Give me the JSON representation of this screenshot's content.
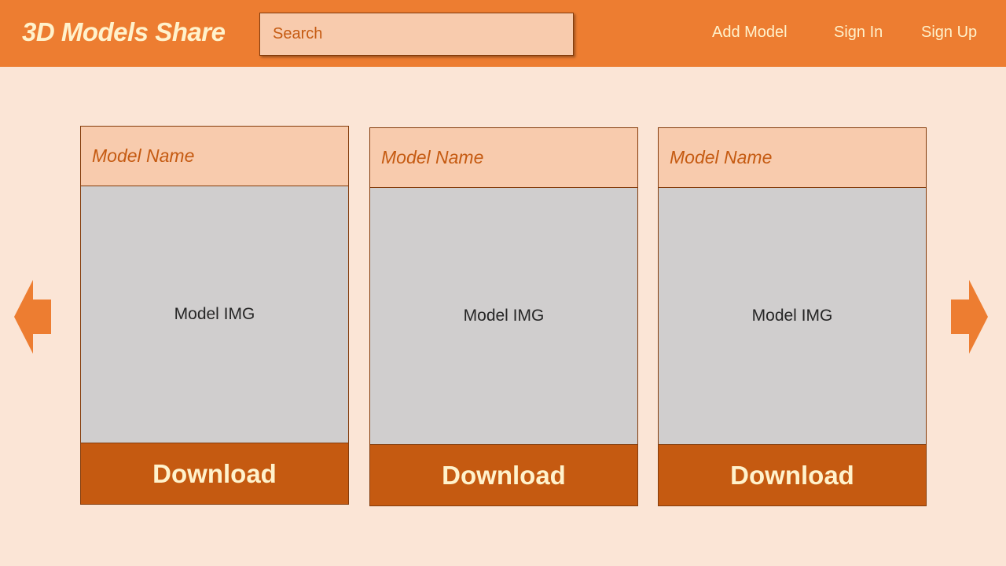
{
  "header": {
    "brand": "3D Models Share",
    "search_placeholder": "Search",
    "nav": {
      "add_model": "Add Model",
      "sign_in": "Sign In",
      "sign_up": "Sign Up"
    }
  },
  "cards": [
    {
      "name": "Model Name",
      "image_label": "Model IMG",
      "download_label": "Download"
    },
    {
      "name": "Model Name",
      "image_label": "Model IMG",
      "download_label": "Download"
    },
    {
      "name": "Model Name",
      "image_label": "Model IMG",
      "download_label": "Download"
    }
  ],
  "carousel": {
    "prev_icon": "arrow-left-icon",
    "next_icon": "arrow-right-icon"
  },
  "colors": {
    "header_bg": "#ED7D31",
    "page_bg": "#FBE5D6",
    "card_header_bg": "#F8CBAD",
    "image_placeholder_bg": "#D0CECE",
    "download_bg": "#C55A11",
    "light_text": "#FFF2CC",
    "border": "#843C0C"
  }
}
